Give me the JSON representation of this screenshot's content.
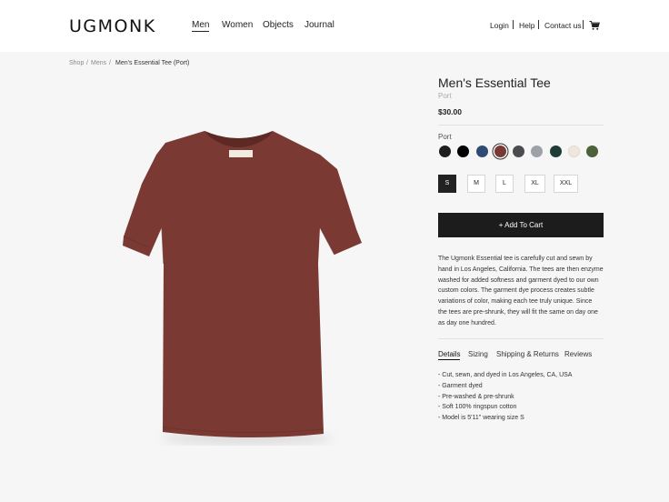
{
  "brand": {
    "logo": "UGMONK"
  },
  "nav": {
    "items": [
      {
        "label": "Men",
        "active": true
      },
      {
        "label": "Women"
      },
      {
        "label": "Objects"
      },
      {
        "label": "Journal"
      }
    ]
  },
  "utility": {
    "login": "Login",
    "help": "Help",
    "contact": "Contact us",
    "cart_icon": "cart-icon"
  },
  "breadcrumb": {
    "items": [
      "Shop",
      "Mens"
    ],
    "separator": "/",
    "current": "Men's Essential Tee (Port)"
  },
  "product": {
    "title": "Men's Essential Tee",
    "color_name": "Port",
    "price": "$30.00",
    "color_label": "Port",
    "shirt_color": "#7a3a33",
    "colors": [
      {
        "hex": "#1e1e1e"
      },
      {
        "hex": "#000000"
      },
      {
        "hex": "#2f4a73"
      },
      {
        "hex": "#7a3a33",
        "selected": true
      },
      {
        "hex": "#4b4c50"
      },
      {
        "hex": "#9ea1a8"
      },
      {
        "hex": "#1f3b38"
      },
      {
        "hex": "#efe7dc"
      },
      {
        "hex": "#4d6238"
      }
    ],
    "sizes": [
      "S",
      "M",
      "L",
      "XL",
      "XXL"
    ],
    "selected_size": "S",
    "add_to_cart": "+ Add To Cart",
    "description_lines": [
      "The Ugmonk Essential tee is carefully cut and sewn by",
      "hand in Los Angeles, California. The tees are then enzyme",
      "washed for added softness and garment dyed to our own",
      "custom colors. The garment dye process creates subtle",
      "variations of color, making each tee truly unique. Since",
      "the tees are pre-shrunk, they will fit the same on day one",
      "as day one hundred."
    ],
    "tabs": [
      "Details",
      "Sizing",
      "Shipping & Returns",
      "Reviews"
    ],
    "active_tab": "Details",
    "details": [
      "- Cut, sewn, and dyed in Los Angeles, CA, USA",
      "- Garment dyed",
      "- Pre-washed & pre-shrunk",
      "- Soft 100% ringspun cotton",
      "- Model is 5'11\" wearing size S"
    ]
  }
}
